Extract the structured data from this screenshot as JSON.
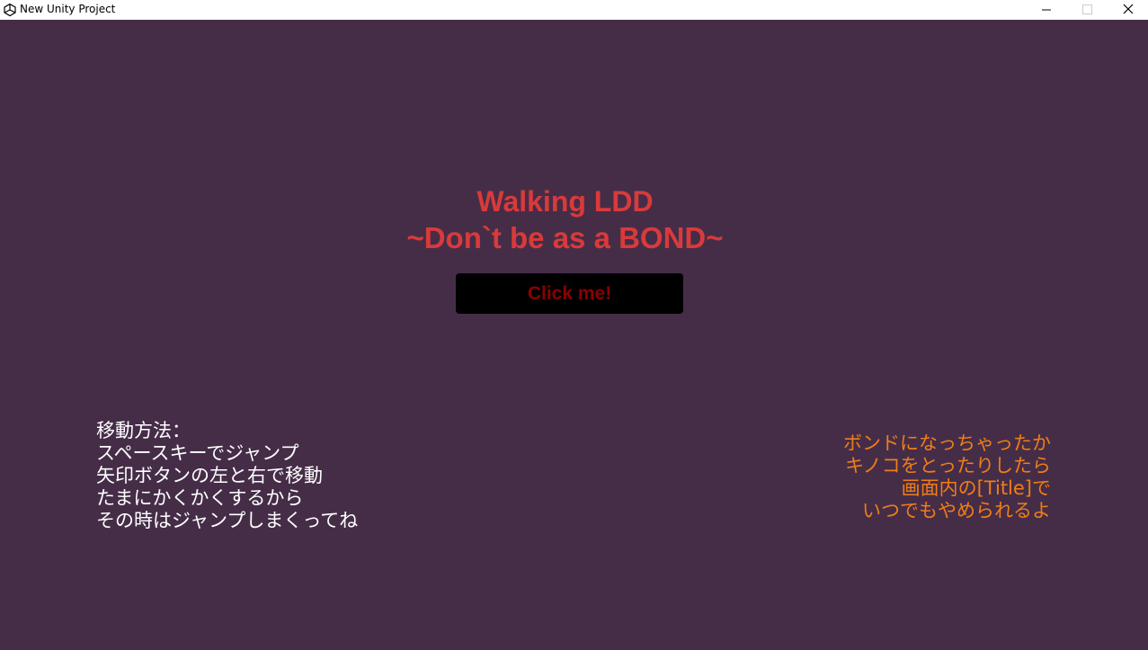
{
  "window": {
    "title": "New Unity Project",
    "icon": "unity-logo-icon",
    "controls": [
      "minimize-icon",
      "maximize-icon",
      "close-icon"
    ]
  },
  "game": {
    "background_color": "#452d48",
    "title_line_1": "Walking LDD",
    "title_line_2": "~Don`t be as a BOND~",
    "title_color": "#d93a3a",
    "button_label": "Click me!",
    "button_color": "#000000",
    "button_text_color": "#8b0000",
    "instructions": [
      "移動方法：",
      "スペースキーでジャンプ",
      "矢印ボタンの左と右で移動",
      "たまにかくかくするから",
      "その時はジャンプしまくってね"
    ],
    "note": [
      "ボンドになっちゃったか",
      "キノコをとったりしたら",
      "画面内の[Title]で",
      "いつでもやめられるよ"
    ],
    "note_color": "#f07d17"
  }
}
